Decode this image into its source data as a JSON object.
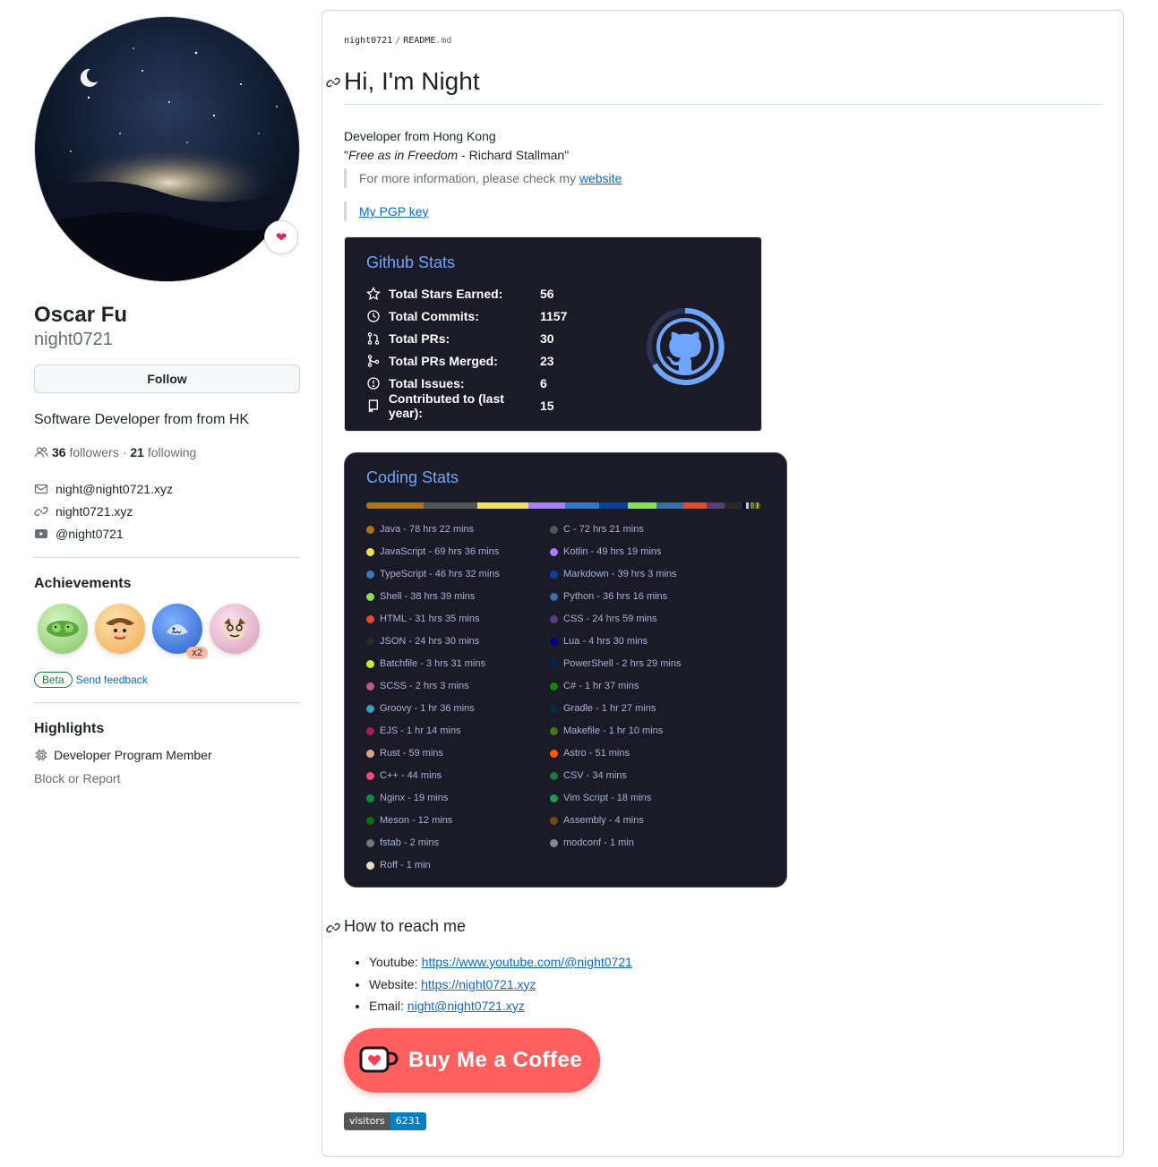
{
  "profile": {
    "name": "Oscar Fu",
    "login": "night0721",
    "follow_label": "Follow",
    "bio": "Software Developer from from HK",
    "followers_count": "36",
    "followers_label": "followers",
    "separator": "·",
    "following_count": "21",
    "following_label": "following",
    "email": "night@night0721.xyz",
    "website": "night0721.xyz",
    "youtube": "@night0721",
    "status_icon": "heart-icon"
  },
  "achievements": {
    "title": "Achievements",
    "badges": [
      {
        "icon": "pair-extraordinaire-icon",
        "color": "#b7e3a1"
      },
      {
        "icon": "yolo-icon",
        "color": "#f5c57a"
      },
      {
        "icon": "pull-shark-icon",
        "color": "#3f74d9",
        "count": "x2"
      },
      {
        "icon": "quickdraw-icon",
        "color": "#f4c8d8"
      }
    ],
    "beta_label": "Beta",
    "feedback_label": "Send feedback"
  },
  "highlights": {
    "title": "Highlights",
    "item": "Developer Program Member",
    "block_label": "Block or Report"
  },
  "readme": {
    "crumb_user": "night0721",
    "crumb_sep": "/",
    "crumb_file": "README",
    "crumb_ext": ".md",
    "heading": "Hi, I'm Night",
    "intro_line1": "Developer from Hong Kong",
    "quote_open": "\"",
    "quote_italic": "Free as in Freedom",
    "quote_rest": " - Richard Stallman\"",
    "info_text": "For more information, please check my ",
    "info_link": "website",
    "pgp_link": "My PGP key",
    "reach_heading": "How to reach me",
    "contacts": [
      {
        "label": "Youtube: ",
        "value": "https://www.youtube.com/@night0721"
      },
      {
        "label": "Website: ",
        "value": "https://night0721.xyz"
      },
      {
        "label": "Email: ",
        "value": "night@night0721.xyz"
      }
    ],
    "bmac_label": "Buy Me a Coffee",
    "visitors_label": "visitors",
    "visitors_count": "6231"
  },
  "github_stats": {
    "title": "Github Stats",
    "rows": [
      {
        "icon": "star-icon",
        "label": "Total Stars Earned:",
        "value": "56"
      },
      {
        "icon": "history-icon",
        "label": "Total Commits:",
        "value": "1157"
      },
      {
        "icon": "pull-request-icon",
        "label": "Total PRs:",
        "value": "30"
      },
      {
        "icon": "merge-icon",
        "label": "Total PRs Merged:",
        "value": "23"
      },
      {
        "icon": "issue-icon",
        "label": "Total Issues:",
        "value": "6"
      },
      {
        "icon": "repo-icon",
        "label": "Contributed to (last year):",
        "value": "15"
      }
    ],
    "accent": "#70a5fd"
  },
  "coding_stats": {
    "title": "Coding Stats",
    "left": [
      {
        "text": "Java - 78 hrs 22 mins",
        "color": "#b07219"
      },
      {
        "text": "JavaScript - 69 hrs 36 mins",
        "color": "#f1e05a"
      },
      {
        "text": "TypeScript - 46 hrs 32 mins",
        "color": "#3178c6"
      },
      {
        "text": "Shell - 38 hrs 39 mins",
        "color": "#89e051"
      },
      {
        "text": "HTML - 31 hrs 35 mins",
        "color": "#e34c26"
      },
      {
        "text": "JSON - 24 hrs 30 mins",
        "color": "#292929"
      },
      {
        "text": "Batchfile - 3 hrs 31 mins",
        "color": "#c1f12e"
      },
      {
        "text": "SCSS - 2 hrs 3 mins",
        "color": "#c6538c"
      },
      {
        "text": "Groovy - 1 hr 36 mins",
        "color": "#4298b8"
      },
      {
        "text": "EJS - 1 hr 14 mins",
        "color": "#a91e50"
      },
      {
        "text": "Rust - 59 mins",
        "color": "#dea584"
      },
      {
        "text": "C++ - 44 mins",
        "color": "#f34b7d"
      },
      {
        "text": "Nginx - 19 mins",
        "color": "#009639"
      },
      {
        "text": "Meson - 12 mins",
        "color": "#007800"
      },
      {
        "text": "fstab - 2 mins",
        "color": "#777777"
      },
      {
        "text": "Roff - 1 min",
        "color": "#ecdebe"
      }
    ],
    "right": [
      {
        "text": "C - 72 hrs 21 mins",
        "color": "#555555"
      },
      {
        "text": "Kotlin - 49 hrs 19 mins",
        "color": "#a97bff"
      },
      {
        "text": "Markdown - 39 hrs 3 mins",
        "color": "#083fa1"
      },
      {
        "text": "Python - 36 hrs 16 mins",
        "color": "#3572a5"
      },
      {
        "text": "CSS - 24 hrs 59 mins",
        "color": "#563d7c"
      },
      {
        "text": "Lua - 4 hrs 30 mins",
        "color": "#000080"
      },
      {
        "text": "PowerShell - 2 hrs 29 mins",
        "color": "#012456"
      },
      {
        "text": "C# - 1 hr 37 mins",
        "color": "#178600"
      },
      {
        "text": "Gradle - 1 hr 27 mins",
        "color": "#02303a"
      },
      {
        "text": "Makefile - 1 hr 10 mins",
        "color": "#427819"
      },
      {
        "text": "Astro - 51 mins",
        "color": "#ff5a03"
      },
      {
        "text": "CSV - 34 mins",
        "color": "#237346"
      },
      {
        "text": "Vim Script - 18 mins",
        "color": "#199f4b"
      },
      {
        "text": "Assembly - 4 mins",
        "color": "#6e4c13"
      },
      {
        "text": "modconf - 1 min",
        "color": "#888888"
      }
    ],
    "bar_weights": [
      78.4,
      72.4,
      69.6,
      49.3,
      46.5,
      39.1,
      38.7,
      36.3,
      31.6,
      25.0,
      24.5,
      4.5,
      3.5,
      2.5,
      2.0,
      1.6,
      1.6,
      1.5,
      1.2,
      1.2,
      1.0,
      0.9,
      0.7,
      0.6,
      0.3,
      0.3,
      0.2,
      0.1,
      0.1,
      0.05,
      0.02
    ],
    "bar_colors": [
      "#b07219",
      "#555555",
      "#f1e05a",
      "#a97bff",
      "#3178c6",
      "#083fa1",
      "#89e051",
      "#3572a5",
      "#e34c26",
      "#563d7c",
      "#292929",
      "#000080",
      "#c1f12e",
      "#012456",
      "#c6538c",
      "#178600",
      "#4298b8",
      "#02303a",
      "#a91e50",
      "#427819",
      "#dea584",
      "#ff5a03",
      "#f34b7d",
      "#237346",
      "#009639",
      "#199f4b",
      "#007800",
      "#6e4c13",
      "#777777",
      "#888888",
      "#ecdebe"
    ]
  }
}
